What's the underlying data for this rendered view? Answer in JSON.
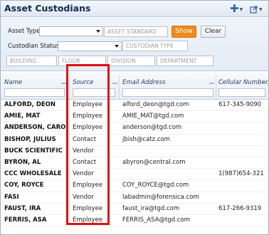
{
  "header": {
    "title": "Asset Custodians",
    "add_icon": "plus-icon",
    "export_icon": "export-icon"
  },
  "filters": {
    "asset_type_label": "Asset Type",
    "asset_type_value": "",
    "asset_standard_placeholder": "ASSET STANDARD",
    "custodian_status_label": "Custodian Status",
    "custodian_status_value": "",
    "custodian_type_placeholder": "CUSTODIAN TYPE",
    "building_placeholder": "BUILDING",
    "floor_placeholder": "FLOOR",
    "division_placeholder": "DIVISION",
    "department_placeholder": "DEPARTMENT",
    "show_label": "Show",
    "clear_label": "Clear"
  },
  "grid": {
    "columns": [
      "Name",
      "Source",
      "Email Address",
      "Cellular Number"
    ],
    "rows": [
      {
        "name": "ALFORD, DEON",
        "source": "Employee",
        "email": "alford_deon@tgd.com",
        "phone": "617-345-9090"
      },
      {
        "name": "AMIE, MAT",
        "source": "Employee",
        "email": "AMIE_MAT@tgd.com",
        "phone": ""
      },
      {
        "name": "ANDERSON, CAROLINE",
        "source": "Employee",
        "email": "anderson@tgd.com",
        "phone": ""
      },
      {
        "name": "BISHOP, JULIUS",
        "source": "Contact",
        "email": "jbish@catz.com",
        "phone": ""
      },
      {
        "name": "BUCK SCIENTIFIC",
        "source": "Vendor",
        "email": "",
        "phone": ""
      },
      {
        "name": "BYRON, AL",
        "source": "Contact",
        "email": "abyron@central.com",
        "phone": ""
      },
      {
        "name": "CCC WHOLESALE",
        "source": "Vendor",
        "email": "",
        "phone": "1(987)654-3210"
      },
      {
        "name": "COY, ROYCE",
        "source": "Employee",
        "email": "COY_ROYCE@tgd.com",
        "phone": ""
      },
      {
        "name": "FASI",
        "source": "Vendor",
        "email": "labadmin@forensica.com",
        "phone": ""
      },
      {
        "name": "FAUST, IRA",
        "source": "Employee",
        "email": "faust_ira@tgd.com",
        "phone": "617-266-9319"
      },
      {
        "name": "FERRIS, ASA",
        "source": "Employee",
        "email": "FERRIS_ASA@tgd.com",
        "phone": ""
      }
    ]
  }
}
